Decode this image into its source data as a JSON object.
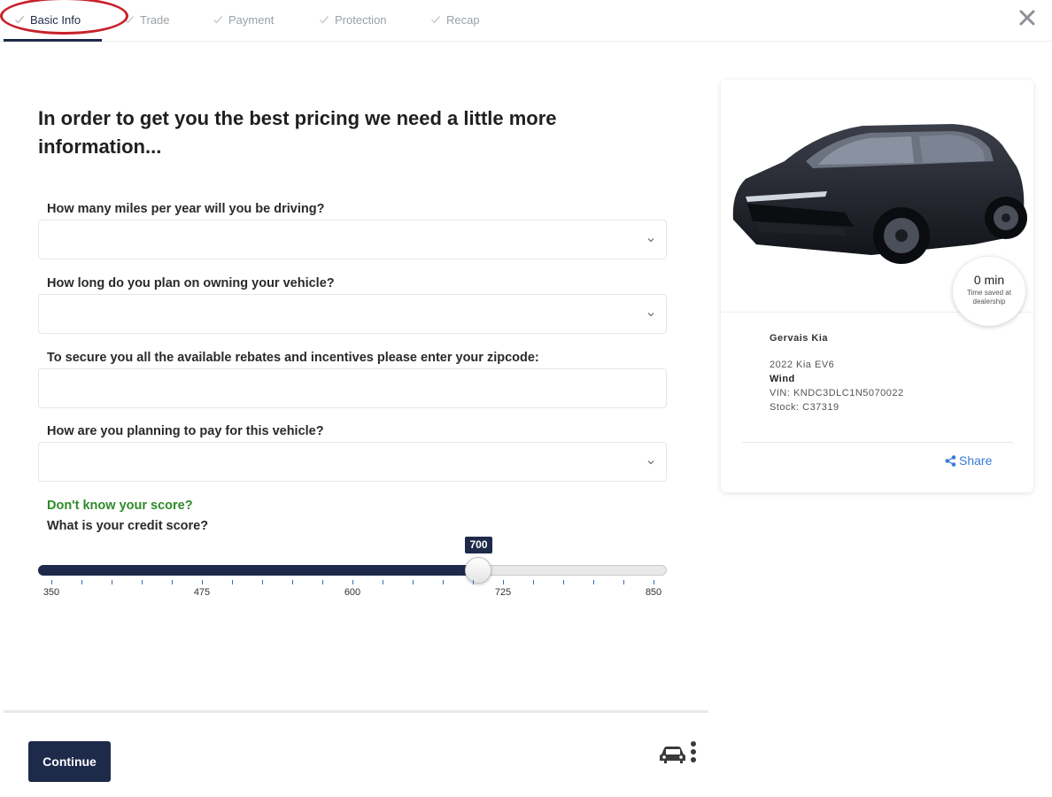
{
  "tabs": [
    {
      "label": "Basic Info",
      "active": true
    },
    {
      "label": "Trade",
      "active": false
    },
    {
      "label": "Payment",
      "active": false
    },
    {
      "label": "Protection",
      "active": false
    },
    {
      "label": "Recap",
      "active": false
    }
  ],
  "close_icon": "close-icon",
  "form": {
    "heading": "In order to get you the best pricing we need a little more information...",
    "questions": [
      {
        "label": "How many miles per year will you be driving?",
        "type": "select",
        "value": ""
      },
      {
        "label": "How long do you plan on owning your vehicle?",
        "type": "select",
        "value": ""
      },
      {
        "label": "To secure you all the available rebates and incentives please enter your zipcode:",
        "type": "text",
        "value": "",
        "placeholder": ""
      },
      {
        "label": "How are you planning to pay for this vehicle?",
        "type": "select",
        "value": ""
      }
    ],
    "score_link": "Don't know your score?",
    "credit_label": "What is your credit score?",
    "credit_slider": {
      "min": 350,
      "max": 850,
      "value": 700,
      "value_label": "700",
      "tick_labels": [
        "350",
        "475",
        "600",
        "725",
        "850"
      ],
      "minor_tick_count": 21
    },
    "continue_label": "Continue"
  },
  "vehicle_card": {
    "time_saved_value": "0 min",
    "time_saved_caption": "Time saved at dealership",
    "dealer": "Gervais Kia",
    "vehicle": "2022 Kia EV6",
    "trim": "Wind",
    "vin": "VIN: KNDC3DLC1N5070022",
    "stock": "Stock: C37319",
    "share_label": "Share"
  },
  "colors": {
    "navy": "#1e2a4a",
    "green_link": "#2f8a2a",
    "share_blue": "#3a7bd5",
    "annotation_red": "#c8202b"
  }
}
